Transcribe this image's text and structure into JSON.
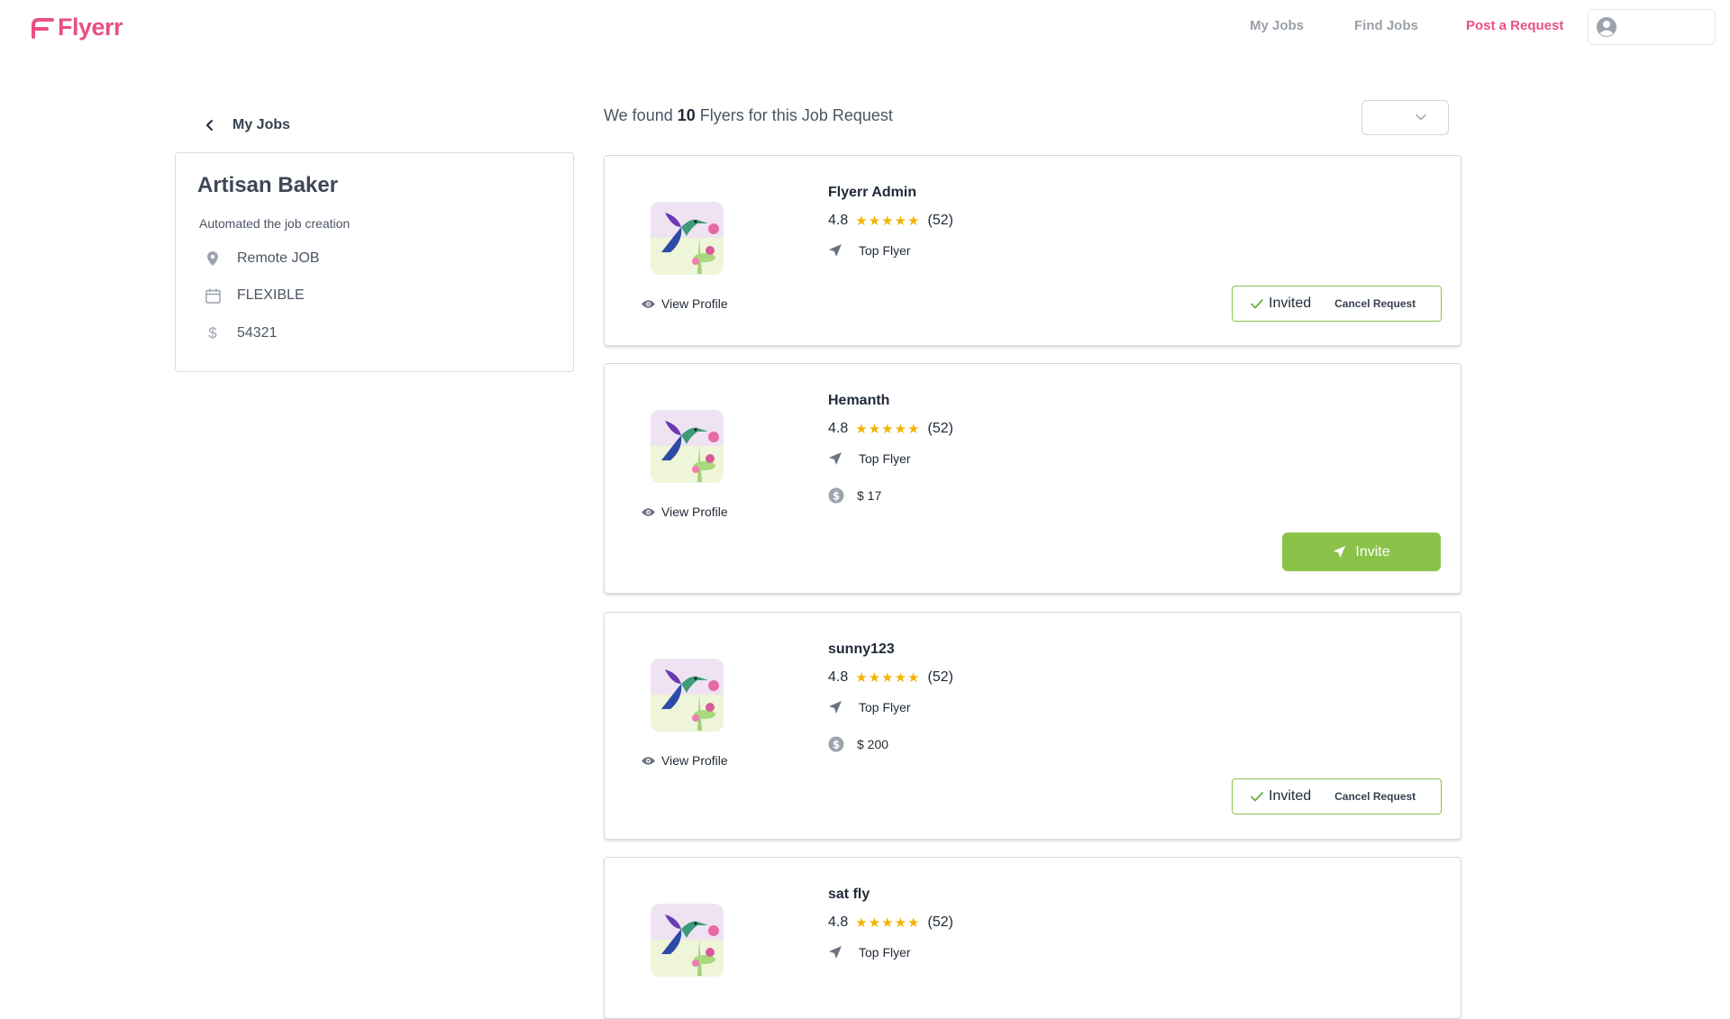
{
  "header": {
    "brand": "Flyerr",
    "nav": {
      "my_jobs": "My Jobs",
      "find_jobs": "Find Jobs",
      "post_request": "Post a Request"
    },
    "accent_color": "#e94f87"
  },
  "job": {
    "back_label": "My Jobs",
    "title": "Artisan Baker",
    "description": "Automated the job creation",
    "location": "Remote JOB",
    "schedule": "FLEXIBLE",
    "budget": "54321"
  },
  "results": {
    "prefix": "We found",
    "count": "10",
    "suffix": "Flyers for this Job Request",
    "sort_value": ""
  },
  "flyers": [
    {
      "name": "Flyerr Admin",
      "rating": "4.8",
      "stars": 5,
      "reviews": "(52)",
      "badge": "Top Flyer",
      "rate": "",
      "status": "invited",
      "view_profile": "View Profile",
      "invited_label": "Invited",
      "cancel_label": "Cancel Request"
    },
    {
      "name": "Hemanth",
      "rating": "4.8",
      "stars": 5,
      "reviews": "(52)",
      "badge": "Top Flyer",
      "rate": "$ 17",
      "status": "invite",
      "view_profile": "View Profile",
      "invite_label": "Invite"
    },
    {
      "name": "sunny123",
      "rating": "4.8",
      "stars": 5,
      "reviews": "(52)",
      "badge": "Top Flyer",
      "rate": "$ 200",
      "status": "invited",
      "view_profile": "View Profile",
      "invited_label": "Invited",
      "cancel_label": "Cancel Request"
    },
    {
      "name": "sat fly",
      "rating": "4.8",
      "stars": 5,
      "reviews": "(52)",
      "badge": "Top Flyer"
    }
  ],
  "icons": {
    "location": "map-pin-icon",
    "calendar": "calendar-icon",
    "dollar": "dollar-icon",
    "back": "chevron-left-icon",
    "eye": "eye-icon",
    "send": "send-icon",
    "coin": "coin-icon",
    "check": "check-icon",
    "star": "star-icon"
  },
  "colors": {
    "invite_green": "#8bc34a",
    "star_gold": "#f5b301"
  }
}
